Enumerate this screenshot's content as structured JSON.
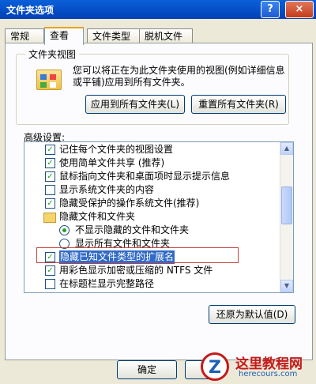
{
  "window": {
    "title": "文件夹选项",
    "help_glyph": "?",
    "close_glyph": "×"
  },
  "tabs": [
    {
      "label": "常规"
    },
    {
      "label": "查看"
    },
    {
      "label": "文件类型"
    },
    {
      "label": "脱机文件"
    }
  ],
  "folder_view": {
    "title": "文件夹视图",
    "description": "您可以将正在为此文件夹使用的视图(例如详细信息或平铺)应用到所有文件夹。",
    "apply_label": "应用到所有文件夹(L)",
    "reset_label": "重置所有文件夹(R)"
  },
  "advanced": {
    "label": "高级设置:",
    "items": [
      {
        "type": "check",
        "checked": true,
        "label": "记住每个文件夹的视图设置"
      },
      {
        "type": "check",
        "checked": true,
        "label": "使用简单文件共享 (推荐)"
      },
      {
        "type": "check",
        "checked": true,
        "label": "鼠标指向文件夹和桌面项时显示提示信息"
      },
      {
        "type": "check",
        "checked": false,
        "label": "显示系统文件夹的内容"
      },
      {
        "type": "check",
        "checked": true,
        "label": "隐藏受保护的操作系统文件(推荐)"
      },
      {
        "type": "folder",
        "label": "隐藏文件和文件夹"
      },
      {
        "type": "radio",
        "checked": true,
        "label": "不显示隐藏的文件和文件夹"
      },
      {
        "type": "radio",
        "checked": false,
        "label": "显示所有文件和文件夹"
      },
      {
        "type": "check",
        "checked": true,
        "label": "隐藏已知文件类型的扩展名"
      },
      {
        "type": "check",
        "checked": true,
        "label": "用彩色显示加密或压缩的 NTFS 文件"
      },
      {
        "type": "check",
        "checked": false,
        "label": "在标题栏显示完整路径"
      }
    ],
    "check_glyph": "✓"
  },
  "restore_label": "还原为默认值(D)",
  "ok_label": "确定",
  "watermark": {
    "title": "这里教程网",
    "url": "herecours.com",
    "logo": "Z"
  },
  "colors": {
    "title_bar": "#0a5fd8",
    "highlight_border": "#c94040",
    "selection": "#316ac5"
  }
}
